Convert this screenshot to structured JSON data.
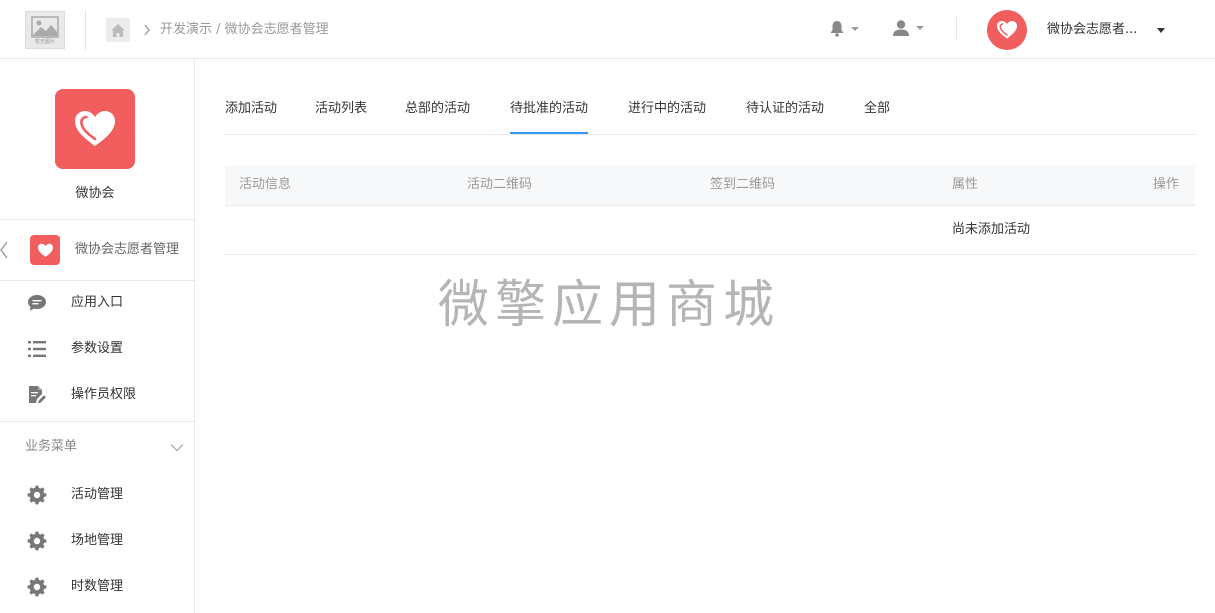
{
  "header": {
    "logo_caption": "暂无图片",
    "breadcrumb": "开发演示 / 微协会志愿者管理",
    "account_name": "微协会志愿者..."
  },
  "sidebar": {
    "app_name": "微协会",
    "module_name": "微协会志愿者管理",
    "items": [
      {
        "label": "应用入口",
        "icon": "chat-bubble-icon"
      },
      {
        "label": "参数设置",
        "icon": "list-settings-icon"
      },
      {
        "label": "操作员权限",
        "icon": "document-edit-icon"
      }
    ],
    "section_label": "业务菜单",
    "business_items": [
      {
        "label": "活动管理",
        "icon": "gear-icon"
      },
      {
        "label": "场地管理",
        "icon": "gear-icon"
      },
      {
        "label": "时数管理",
        "icon": "gear-icon"
      }
    ]
  },
  "tabs": [
    {
      "label": "添加活动",
      "active": false
    },
    {
      "label": "活动列表",
      "active": false
    },
    {
      "label": "总部的活动",
      "active": false
    },
    {
      "label": "待批准的活动",
      "active": true
    },
    {
      "label": "进行中的活动",
      "active": false
    },
    {
      "label": "待认证的活动",
      "active": false
    },
    {
      "label": "全部",
      "active": false
    }
  ],
  "table": {
    "columns": [
      "活动信息",
      "活动二维码",
      "签到二维码",
      "属性",
      "操作"
    ],
    "empty_text": "尚未添加活动"
  },
  "watermark": "微擎应用商城",
  "colors": {
    "brand": "#f25d5d",
    "tab_active": "#3296fa"
  }
}
